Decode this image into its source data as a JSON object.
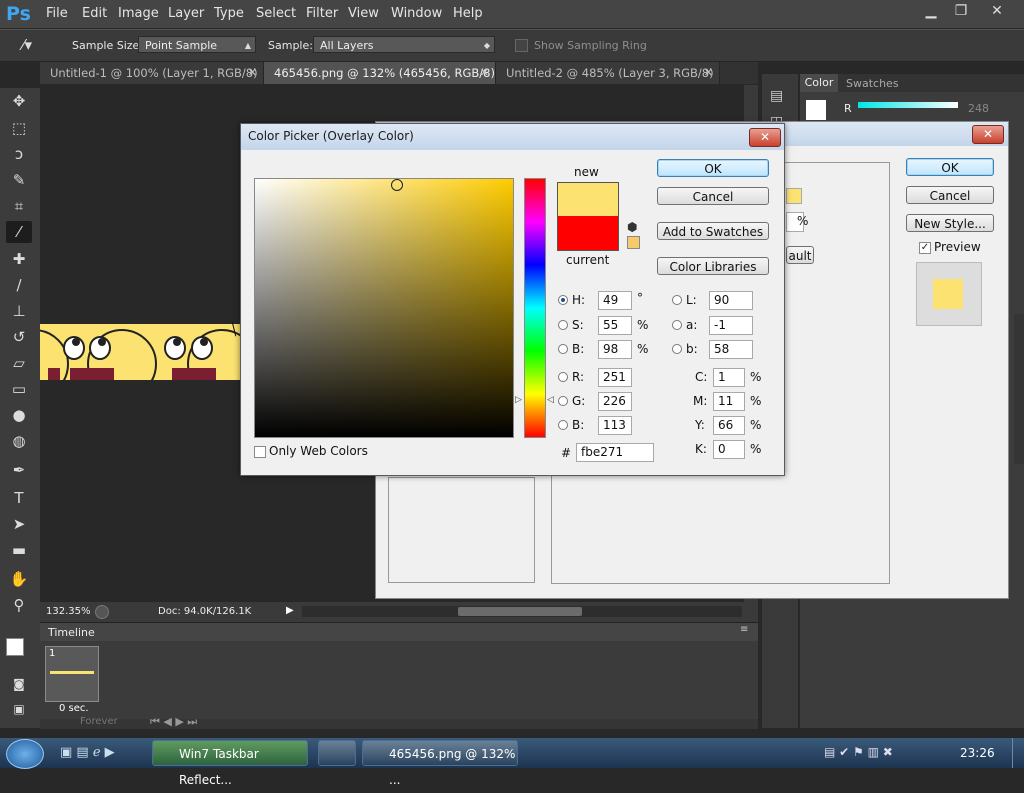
{
  "app": {
    "logo": "Ps",
    "menu": [
      "File",
      "Edit",
      "Image",
      "Layer",
      "Type",
      "Select",
      "Filter",
      "View",
      "Window",
      "Help"
    ],
    "window_controls": [
      "minimize-icon",
      "restore-icon",
      "close-icon"
    ]
  },
  "options_bar": {
    "sample_size_label": "Sample Size:",
    "sample_size_value": "Point Sample",
    "sample_label": "Sample:",
    "sample_value": "All Layers",
    "show_ring_label": "Show Sampling Ring"
  },
  "doc_tabs": [
    {
      "label": "Untitled-1 @ 100% (Layer 1, RGB/8) *",
      "active": false
    },
    {
      "label": "465456.png @ 132% (465456, RGB/8) *",
      "active": true
    },
    {
      "label": "Untitled-2 @ 485% (Layer 3, RGB/8) *",
      "active": false
    }
  ],
  "status": {
    "zoom": "132.35%",
    "doc": "Doc: 94.0K/126.1K"
  },
  "timeline": {
    "title": "Timeline",
    "frame_number": "1",
    "frame_delay": "0 sec.",
    "loop": "Forever"
  },
  "right_panel": {
    "tabs": [
      "Color",
      "Swatches"
    ],
    "channel": "R",
    "channel_value": "248"
  },
  "layer_style": {
    "ok": "OK",
    "cancel": "Cancel",
    "new_style": "New Style...",
    "preview": "Preview",
    "default_btn": "ault",
    "percent": "%"
  },
  "color_picker": {
    "title": "Color Picker (Overlay Color)",
    "ok": "OK",
    "cancel": "Cancel",
    "add_to_swatches": "Add to Swatches",
    "color_libraries": "Color Libraries",
    "new_label": "new",
    "current_label": "current",
    "new_color": "#fbe271",
    "current_color": "#ff0000",
    "only_web_colors": "Only Web Colors",
    "hsb": [
      {
        "label": "H:",
        "value": "49",
        "unit": "°",
        "selected": true
      },
      {
        "label": "S:",
        "value": "55",
        "unit": "%",
        "selected": false
      },
      {
        "label": "B:",
        "value": "98",
        "unit": "%",
        "selected": false
      }
    ],
    "rgb": [
      {
        "label": "R:",
        "value": "251"
      },
      {
        "label": "G:",
        "value": "226"
      },
      {
        "label": "B:",
        "value": "113"
      }
    ],
    "lab": [
      {
        "label": "L:",
        "value": "90"
      },
      {
        "label": "a:",
        "value": "-1"
      },
      {
        "label": "b:",
        "value": "58"
      }
    ],
    "cmyk": [
      {
        "label": "C:",
        "value": "1",
        "unit": "%"
      },
      {
        "label": "M:",
        "value": "11",
        "unit": "%"
      },
      {
        "label": "Y:",
        "value": "66",
        "unit": "%"
      },
      {
        "label": "K:",
        "value": "0",
        "unit": "%"
      }
    ],
    "hex_label": "#",
    "hex_value": "fbe271"
  },
  "taskbar": {
    "items": [
      "Win7 Taskbar Reflect...",
      "465456.png @ 132% ..."
    ],
    "time": "23:26"
  },
  "colors": {
    "chrome_dark": "#282828",
    "panel": "#3c3c3c",
    "accent_blue": "#3fa6f2",
    "swatch_yellow": "#fbe271"
  }
}
